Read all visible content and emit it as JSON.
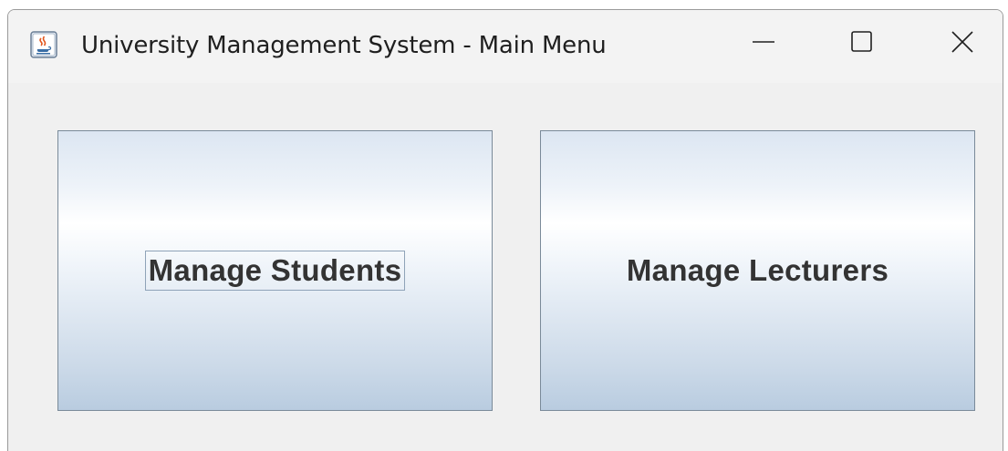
{
  "window": {
    "title": "University Management System - Main Menu",
    "app_icon": "java-coffee-cup-icon",
    "controls": {
      "minimize_icon": "minimize-icon",
      "maximize_icon": "maximize-icon",
      "close_icon": "close-icon"
    }
  },
  "main_menu": {
    "buttons": [
      {
        "label": "Manage Students",
        "focused": true
      },
      {
        "label": "Manage Lecturers",
        "focused": false
      }
    ]
  },
  "colors": {
    "window_background": "#f0f0f0",
    "button_border": "#7a8a99",
    "button_gradient_top": "#dce6f2",
    "button_gradient_mid": "#ffffff",
    "button_gradient_bottom": "#b9cce0",
    "button_text": "#333333",
    "title_text": "#1f1f1f"
  }
}
